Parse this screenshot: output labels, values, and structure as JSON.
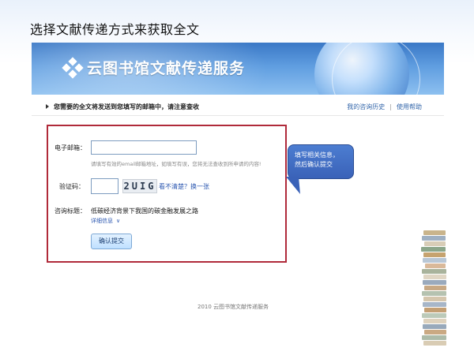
{
  "slide": {
    "title": "选择文献传递方式来获取全文"
  },
  "banner": {
    "brand": "云图书馆文献传递服务"
  },
  "notice": {
    "text": "您需要的全文将发送到您填写的邮箱中，请注意查收",
    "links": [
      "我的咨询历史",
      "使用帮助"
    ]
  },
  "form": {
    "email_label": "电子邮箱：",
    "email_value": "",
    "email_hint": "请填写有效的email邮箱地址，如填写有误，您将无法查收到所申请的内容!",
    "captcha_label": "验证码：",
    "captcha_value": "",
    "captcha_text": "2UIG",
    "refresh_link": "看不清楚？换一张",
    "subject_label": "咨询标题：",
    "subject_value": "低碳经济背景下我国的碳金融发展之路",
    "details_link": "详细信息",
    "submit_label": "确认提交"
  },
  "callout": {
    "text_line1": "填写相关信息，",
    "text_line2": "然后确认提交"
  },
  "footer": {
    "text": "2010  云图书馆文献传递服务"
  },
  "colors": {
    "frame": "#b02a3a",
    "banner": "#3a78c6",
    "link": "#2b57b0",
    "callout": "#3a62b8"
  }
}
